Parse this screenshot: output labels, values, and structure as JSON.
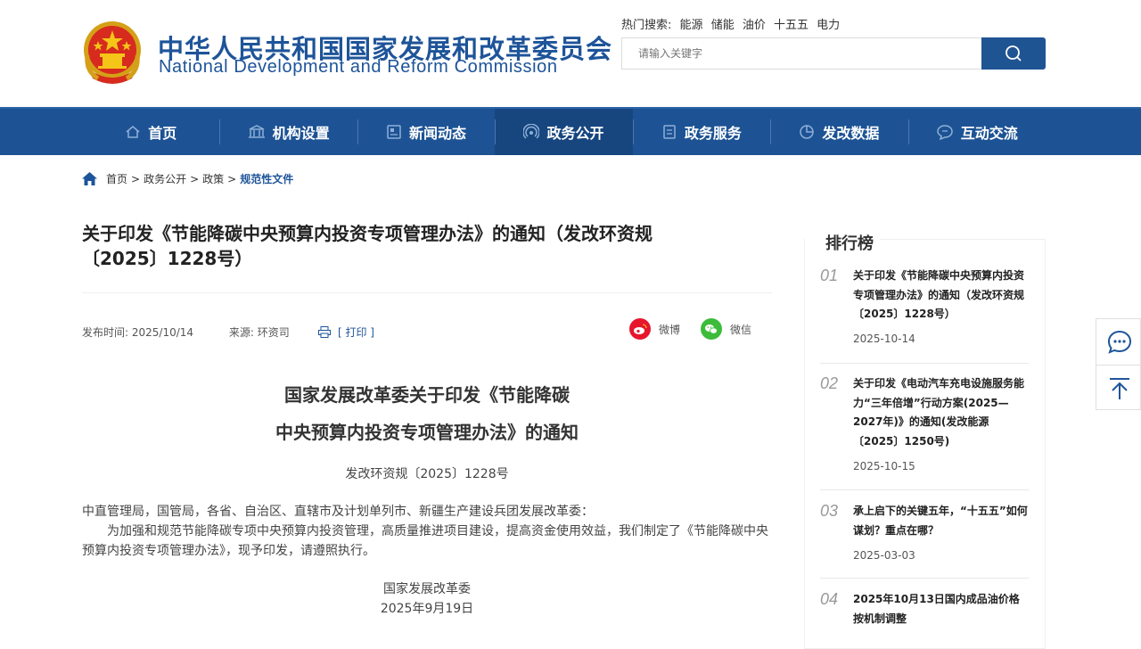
{
  "header": {
    "title_cn": "中华人民共和国国家发展和改革委员会",
    "title_en": "National Development and Reform Commission",
    "hot_label": "热门搜索:",
    "hot_keywords": [
      "能源",
      "储能",
      "油价",
      "十五五",
      "电力"
    ],
    "search_placeholder": "请输入关键字"
  },
  "nav": {
    "items": [
      {
        "label": "首页",
        "icon": "home-icon"
      },
      {
        "label": "机构设置",
        "icon": "building-icon"
      },
      {
        "label": "新闻动态",
        "icon": "news-icon"
      },
      {
        "label": "政务公开",
        "icon": "broadcast-icon",
        "active": true
      },
      {
        "label": "政务服务",
        "icon": "document-icon"
      },
      {
        "label": "发改数据",
        "icon": "pie-chart-icon"
      },
      {
        "label": "互动交流",
        "icon": "chat-icon"
      }
    ]
  },
  "breadcrumb": {
    "items": [
      "首页",
      "政务公开",
      "政策"
    ],
    "current": "规范性文件",
    "separator": ">"
  },
  "article": {
    "title": "关于印发《节能降碳中央预算内投资专项管理办法》的通知（发改环资规〔2025〕1228号）",
    "publish_label": "发布时间:",
    "publish_date": "2025/10/14",
    "source_label": "来源:",
    "source": "环资司",
    "print_label": "[ 打印 ]",
    "share_weibo": "微博",
    "share_wechat": "微信",
    "doc_title_line1": "国家发展改革委关于印发《节能降碳",
    "doc_title_line2": "中央预算内投资专项管理办法》的通知",
    "doc_number": "发改环资规〔2025〕1228号",
    "recipients": "中直管理局，国管局，各省、自治区、直辖市及计划单列市、新疆生产建设兵团发展改革委：",
    "body": "为加强和规范节能降碳专项中央预算内投资管理，高质量推进项目建设，提高资金使用效益，我们制定了《节能降碳中央预算内投资专项管理办法》，现予印发，请遵照执行。",
    "signer": "国家发展改革委",
    "sign_date": "2025年9月19日"
  },
  "ranking": {
    "title": "排行榜",
    "items": [
      {
        "num": "01",
        "title": "关于印发《节能降碳中央预算内投资专项管理办法》的通知（发改环资规〔2025〕1228号）",
        "date": "2025-10-14"
      },
      {
        "num": "02",
        "title": "关于印发《电动汽车充电设施服务能力“三年倍增”行动方案(2025—2027年)》的通知(发改能源〔2025〕1250号)",
        "date": "2025-10-15"
      },
      {
        "num": "03",
        "title": "承上启下的关键五年，“十五五”如何谋划？重点在哪？",
        "date": "2025-03-03"
      },
      {
        "num": "04",
        "title": "2025年10月13日国内成品油价格按机制调整",
        "date": ""
      }
    ]
  },
  "colors": {
    "brand_blue": "#1e5499",
    "nav_bg": "#1d5394",
    "nav_active": "#17467f",
    "weibo_red": "#e6162d",
    "wechat_green": "#3dbb3b"
  }
}
